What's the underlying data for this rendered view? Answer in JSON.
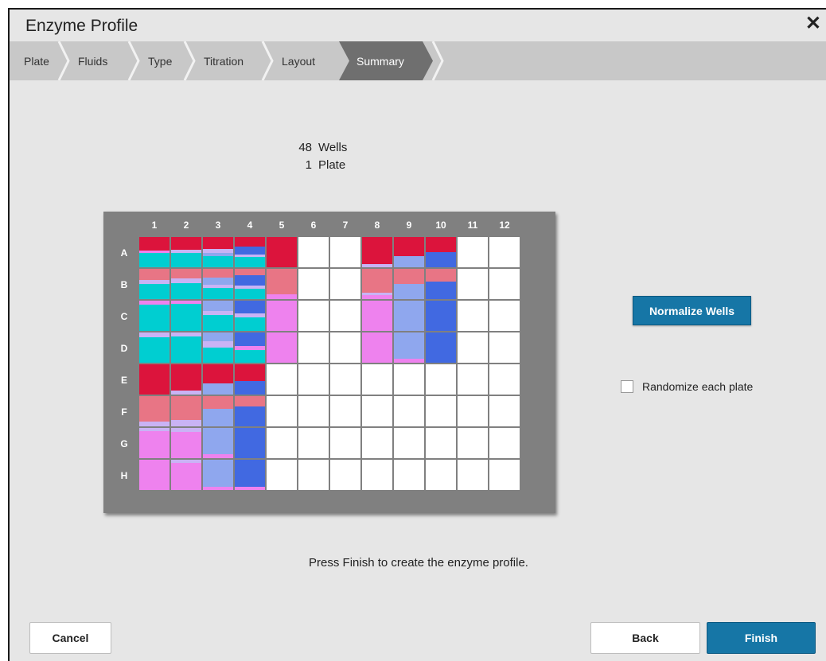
{
  "dialog": {
    "title": "Enzyme Profile",
    "close_label": "✕"
  },
  "steps": [
    {
      "label": "Plate",
      "active": false
    },
    {
      "label": "Fluids",
      "active": false
    },
    {
      "label": "Type",
      "active": false
    },
    {
      "label": "Titration",
      "active": false
    },
    {
      "label": "Layout",
      "active": false
    },
    {
      "label": "Summary",
      "active": true
    }
  ],
  "summary": {
    "wells_count": "48",
    "wells_label": "Wells",
    "plates_count": "1",
    "plates_label": "Plate"
  },
  "plate": {
    "columns": [
      "1",
      "2",
      "3",
      "4",
      "5",
      "6",
      "7",
      "8",
      "9",
      "10",
      "11",
      "12"
    ],
    "rows": [
      "A",
      "B",
      "C",
      "D",
      "E",
      "F",
      "G",
      "H"
    ],
    "colors": {
      "crimson": "#dc143c",
      "rose": "#e87585",
      "pink": "#ee82ee",
      "cyan": "#00ced1",
      "periwinkle": "#8fa7ee",
      "royal": "#4169e1",
      "lavender": "#c9b3f5",
      "empty": "#ffffff"
    },
    "wells": {
      "A": [
        [
          "crimson:0.45",
          "pink:0.08",
          "cyan:0.47"
        ],
        [
          "crimson:0.42",
          "lavender:0.1",
          "cyan:0.48"
        ],
        [
          "crimson:0.4",
          "lavender:0.12",
          "periwinkle:0.12",
          "cyan:0.36"
        ],
        [
          "crimson:0.32",
          "royal:0.25",
          "lavender:0.1",
          "cyan:0.33"
        ],
        [
          "crimson:1"
        ],
        [],
        [],
        [
          "crimson:0.9",
          "lavender:0.1"
        ],
        [
          "crimson:0.62",
          "periwinkle:0.38"
        ],
        [
          "crimson:0.5",
          "royal:0.5"
        ],
        [],
        []
      ],
      "B": [
        [
          "rose:0.38",
          "lavender:0.12",
          "cyan:0.5"
        ],
        [
          "rose:0.32",
          "lavender:0.16",
          "cyan:0.52"
        ],
        [
          "rose:0.28",
          "periwinkle:0.25",
          "lavender:0.1",
          "cyan:0.37"
        ],
        [
          "rose:0.22",
          "royal:0.33",
          "lavender:0.1",
          "cyan:0.35"
        ],
        [
          "rose:0.85",
          "pink:0.15"
        ],
        [],
        [],
        [
          "rose:0.78",
          "lavender:0.1",
          "pink:0.12"
        ],
        [
          "rose:0.5",
          "periwinkle:0.5"
        ],
        [
          "rose:0.42",
          "royal:0.58"
        ],
        [],
        []
      ],
      "C": [
        [
          "pink:0.12",
          "cyan:0.88"
        ],
        [
          "pink:0.1",
          "cyan:0.9"
        ],
        [
          "periwinkle:0.35",
          "lavender:0.12",
          "cyan:0.53"
        ],
        [
          "royal:0.42",
          "lavender:0.12",
          "cyan:0.46"
        ],
        [
          "pink:1"
        ],
        [],
        [],
        [
          "pink:1"
        ],
        [
          "periwinkle:1"
        ],
        [
          "royal:1"
        ],
        [],
        []
      ],
      "D": [
        [
          "lavender:0.15",
          "cyan:0.85"
        ],
        [
          "lavender:0.12",
          "cyan:0.88"
        ],
        [
          "periwinkle:0.3",
          "lavender:0.2",
          "cyan:0.5"
        ],
        [
          "royal:0.45",
          "pink:0.12",
          "cyan:0.43"
        ],
        [
          "pink:1"
        ],
        [],
        [],
        [
          "pink:1"
        ],
        [
          "periwinkle:0.88",
          "pink:0.12"
        ],
        [
          "royal:1"
        ],
        [],
        []
      ],
      "E": [
        [
          "crimson:1"
        ],
        [
          "crimson:0.88",
          "lavender:0.12"
        ],
        [
          "crimson:0.62",
          "periwinkle:0.38"
        ],
        [
          "crimson:0.55",
          "royal:0.45"
        ],
        [],
        [],
        [],
        [],
        [],
        [],
        [],
        []
      ],
      "F": [
        [
          "rose:0.85",
          "lavender:0.15"
        ],
        [
          "rose:0.8",
          "lavender:0.2"
        ],
        [
          "rose:0.42",
          "periwinkle:0.58"
        ],
        [
          "rose:0.35",
          "royal:0.65"
        ],
        [],
        [],
        [],
        [],
        [],
        [],
        [],
        []
      ],
      "G": [
        [
          "lavender:0.1",
          "pink:0.9"
        ],
        [
          "lavender:0.12",
          "pink:0.88"
        ],
        [
          "periwinkle:0.88",
          "pink:0.12"
        ],
        [
          "royal:1"
        ],
        [],
        [],
        [],
        [],
        [],
        [],
        [],
        []
      ],
      "H": [
        [
          "pink:1"
        ],
        [
          "lavender:0.1",
          "pink:0.9"
        ],
        [
          "periwinkle:0.9",
          "pink:0.1"
        ],
        [
          "royal:0.9",
          "pink:0.1"
        ],
        [],
        [],
        [],
        [],
        [],
        [],
        [],
        []
      ]
    }
  },
  "actions": {
    "normalize_label": "Normalize Wells",
    "randomize_label": "Randomize each plate",
    "randomize_checked": false,
    "hint": "Press Finish to create the enzyme profile.",
    "cancel_label": "Cancel",
    "back_label": "Back",
    "finish_label": "Finish"
  }
}
